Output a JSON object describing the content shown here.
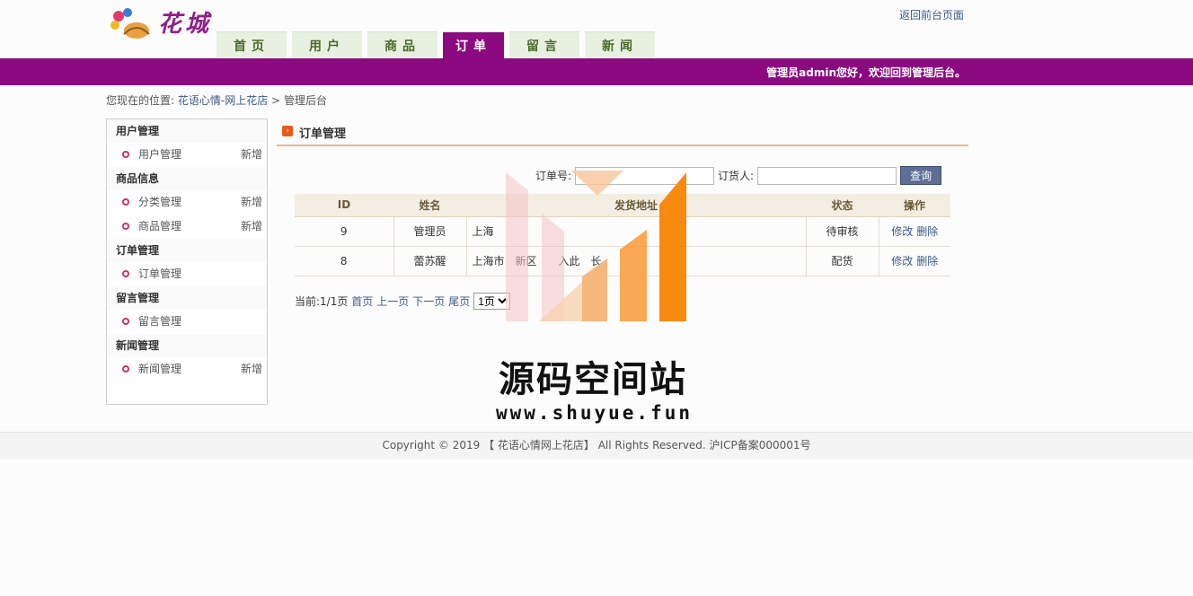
{
  "header": {
    "logo_text": "花城",
    "front_link": "返回前台页面",
    "nav": [
      {
        "label": "首页"
      },
      {
        "label": "用户"
      },
      {
        "label": "商品"
      },
      {
        "label": "订单"
      },
      {
        "label": "留言"
      },
      {
        "label": "新闻"
      }
    ],
    "welcome": "管理员admin您好，欢迎回到管理后台。"
  },
  "breadcrumb": {
    "prefix": "您现在的位置:",
    "home": "花语心情-网上花店",
    "sep": ">",
    "current": "管理后台"
  },
  "sidebar": {
    "groups": [
      {
        "title": "用户管理",
        "items": [
          {
            "label": "用户管理",
            "add": "新增"
          }
        ]
      },
      {
        "title": "商品信息",
        "items": [
          {
            "label": "分类管理",
            "add": "新增"
          },
          {
            "label": "商品管理",
            "add": "新增"
          }
        ]
      },
      {
        "title": "订单管理",
        "items": [
          {
            "label": "订单管理",
            "add": ""
          }
        ]
      },
      {
        "title": "留言管理",
        "items": [
          {
            "label": "留言管理",
            "add": ""
          }
        ]
      },
      {
        "title": "新闻管理",
        "items": [
          {
            "label": "新闻管理",
            "add": "新增"
          }
        ]
      }
    ]
  },
  "main": {
    "title": "订单管理",
    "search": {
      "order_no_label": "订单号:",
      "order_no_value": "",
      "customer_label": "订货人:",
      "customer_value": "",
      "button": "查询"
    },
    "table": {
      "headers": [
        "ID",
        "姓名",
        "发货地址",
        "状态",
        "操作"
      ],
      "rows": [
        {
          "id": "9",
          "name": "管理员",
          "address": "上海",
          "status": "待审核",
          "edit": "修改",
          "delete": "删除"
        },
        {
          "id": "8",
          "name": "蕾苏醒",
          "address": "上海市　新区　　入此　长",
          "status": "配货",
          "edit": "修改",
          "delete": "删除"
        }
      ]
    },
    "pager": {
      "current": "当前:1/1页",
      "first": "首页",
      "prev": "上一页",
      "next": "下一页",
      "last": "尾页",
      "page_select": "1页"
    }
  },
  "watermark": {
    "text": "源码空间站",
    "url": "www.shuyue.fun"
  },
  "footer": {
    "text": "Copyright © 2019 【 花语心情网上花店】 All Rights Reserved. 沪ICP备案000001号"
  },
  "colors": {
    "brand": "#8b0a7f",
    "nav_bg": "#e8f0e0",
    "link": "#3b5a8a"
  }
}
